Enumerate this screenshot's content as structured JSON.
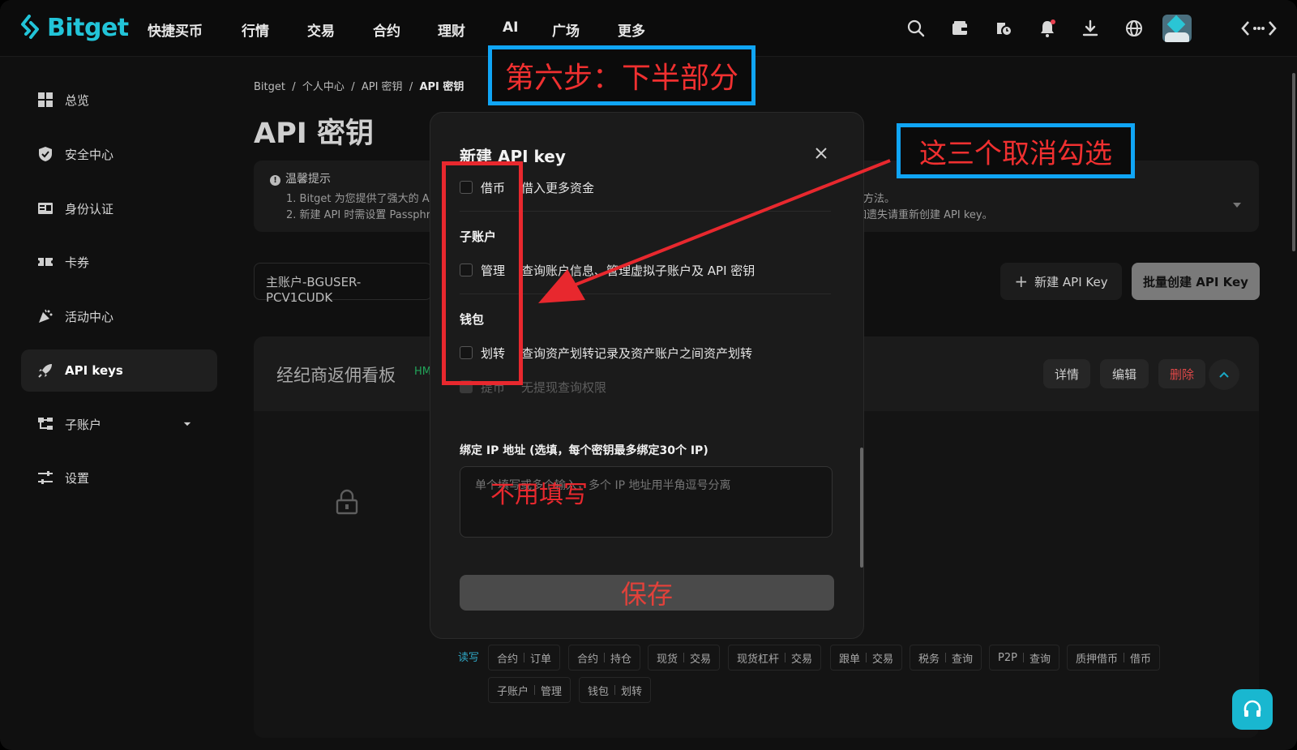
{
  "header": {
    "logo": "Bitget",
    "nav": [
      "快捷买币",
      "行情",
      "交易",
      "合约",
      "理财",
      "AI",
      "广场",
      "更多"
    ]
  },
  "sidebar": {
    "items": [
      {
        "label": "总览",
        "icon": "grid-icon"
      },
      {
        "label": "安全中心",
        "icon": "shield-icon"
      },
      {
        "label": "身份认证",
        "icon": "id-card-icon"
      },
      {
        "label": "卡券",
        "icon": "ticket-icon"
      },
      {
        "label": "活动中心",
        "icon": "party-icon"
      },
      {
        "label": "API keys",
        "icon": "rocket-icon",
        "active": true
      },
      {
        "label": "子账户",
        "icon": "tree-icon"
      },
      {
        "label": "设置",
        "icon": "sliders-icon"
      }
    ]
  },
  "breadcrumb": {
    "items": [
      "Bitget",
      "个人中心",
      "API 密钥",
      "API 密钥"
    ],
    "separator": "/"
  },
  "page": {
    "title": "API 密钥"
  },
  "notice": {
    "title": "温馨提示",
    "line1": "1. Bitget 为您提供了强大的 AI",
    "line2": "2. 新建 API 时需设置 Passphr",
    "line1_tail": "方法。",
    "line2_tail": "，如遗失请重新创建 API key。"
  },
  "account": {
    "name": "主账户-BGUSER-PCV1CUDK"
  },
  "actions": {
    "new_api": "新建 API Key",
    "batch": "批量创建 API Key"
  },
  "card": {
    "title": "经纪商返佣看板",
    "badge": "HM",
    "details": "详情",
    "edit": "编辑",
    "delete": "删除"
  },
  "permissions": {
    "label": "读写",
    "tags": [
      [
        "合约",
        "订单"
      ],
      [
        "合约",
        "持仓"
      ],
      [
        "现货",
        "交易"
      ],
      [
        "现货杠杆",
        "交易"
      ],
      [
        "跟单",
        "交易"
      ],
      [
        "税务",
        "查询"
      ],
      [
        "P2P",
        "查询"
      ],
      [
        "质押借币",
        "借币"
      ],
      [
        "子账户",
        "管理"
      ],
      [
        "钱包",
        "划转"
      ]
    ]
  },
  "modal": {
    "title": "新建 API key",
    "borrow": {
      "name": "借币",
      "desc": "借入更多资金"
    },
    "subaccount_section": "子账户",
    "manage": {
      "name": "管理",
      "desc": "查询账户信息、管理虚拟子账户及 API 密钥"
    },
    "wallet_section": "钱包",
    "transfer": {
      "name": "划转",
      "desc": "查询资产划转记录及资产账户之间资产划转"
    },
    "withdraw": {
      "name": "提币",
      "desc": "无提现查询权限"
    },
    "ip_label": "绑定 IP 地址 (选填，每个密钥最多绑定30个 IP)",
    "ip_placeholder": "单个填写或多个输入，多个 IP 地址用半角逗号分离",
    "save": "保存"
  },
  "annotations": {
    "step": "第六步：下半部分",
    "uncheck": "这三个取消勾选",
    "no_fill": "不用填写",
    "box_color": "#10a5f5",
    "red_color": "#e8282e"
  }
}
